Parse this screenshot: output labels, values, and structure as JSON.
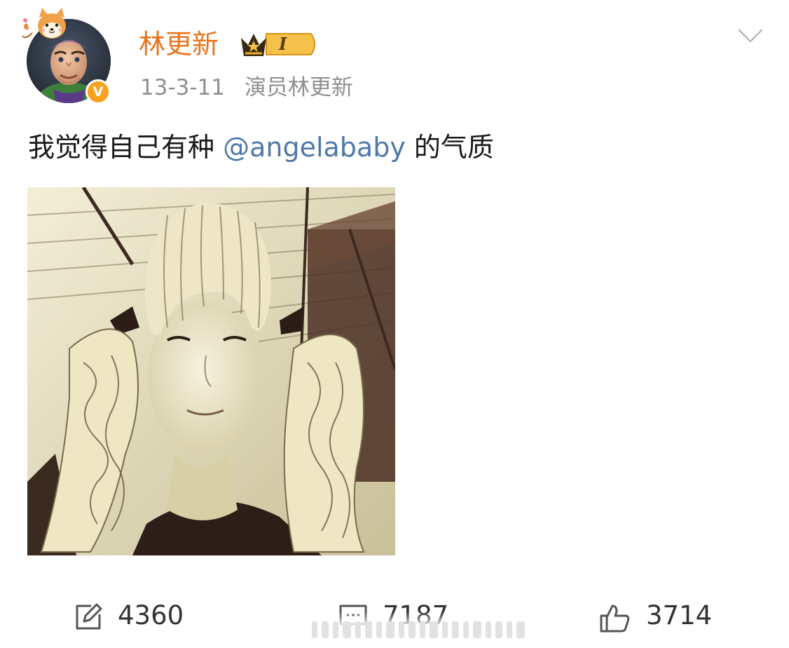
{
  "post": {
    "author": {
      "name": "林更新",
      "level_badge": "I",
      "verified": "V"
    },
    "meta": {
      "date": "13-3-11",
      "source": "演员林更新"
    },
    "text": {
      "before": "我觉得自己有种 ",
      "mention": "@angelababy",
      "after": " 的气质"
    },
    "actions": {
      "repost_count": "4360",
      "comment_count": "7187",
      "like_count": "3714"
    }
  },
  "colors": {
    "username": "#e8741d",
    "mention": "#4e7aa8",
    "meta": "#8f8f8f",
    "verified": "#f7a21c",
    "crown_gold": "#f2b128"
  },
  "icons": {
    "avatar_pendant": "shiba-dog-icon",
    "verified": "verified-v-icon",
    "level": "crown-level-icon",
    "menu": "chevron-down-icon",
    "repost": "repost-edit-icon",
    "comment": "comment-icon",
    "like": "thumbs-up-icon"
  }
}
